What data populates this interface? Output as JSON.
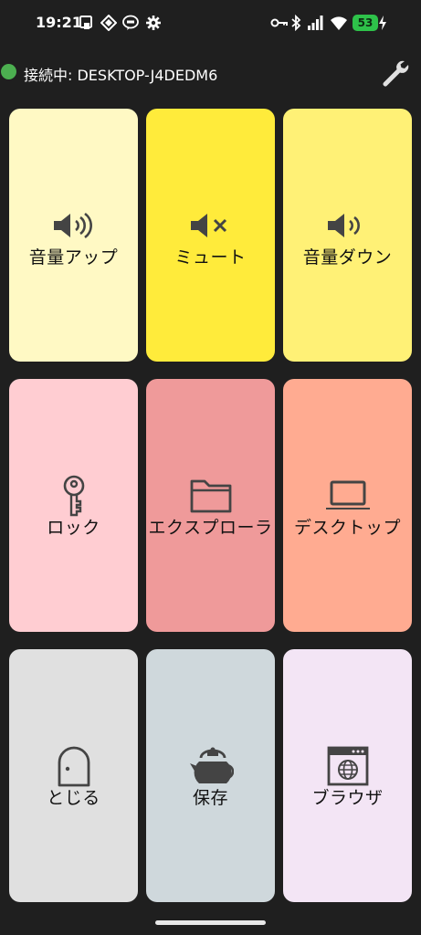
{
  "status_bar": {
    "time": "19:21",
    "battery": "53",
    "icons": [
      "notification-card-icon",
      "app-diamond-icon",
      "line-chat-icon",
      "settings-gear-icon",
      "key-icon",
      "bluetooth-icon",
      "signal-icon",
      "wifi-icon",
      "charging-bolt-icon"
    ]
  },
  "header": {
    "connection_status": "接続中: DESKTOP-J4DEDM6",
    "status_color": "#4caf50",
    "settings_icon": "wrench-icon"
  },
  "tiles": [
    {
      "label": "音量アップ",
      "icon": "volume-up-icon",
      "color": "#fff9c4"
    },
    {
      "label": "ミュート",
      "icon": "mute-icon",
      "color": "#ffeb3b"
    },
    {
      "label": "音量ダウン",
      "icon": "volume-down-icon",
      "color": "#fff176"
    },
    {
      "label": "ロック",
      "icon": "key-icon",
      "color": "#ffcdd2"
    },
    {
      "label": "エクスプローラ",
      "icon": "folder-icon",
      "color": "#ef9a9a"
    },
    {
      "label": "デスクトップ",
      "icon": "laptop-icon",
      "color": "#ffab91"
    },
    {
      "label": "とじる",
      "icon": "door-icon",
      "color": "#e0e0e0"
    },
    {
      "label": "保存",
      "icon": "kettle-icon",
      "color": "#cfd8dc"
    },
    {
      "label": "ブラウザ",
      "icon": "browser-window-icon",
      "color": "#f3e5f5"
    }
  ]
}
